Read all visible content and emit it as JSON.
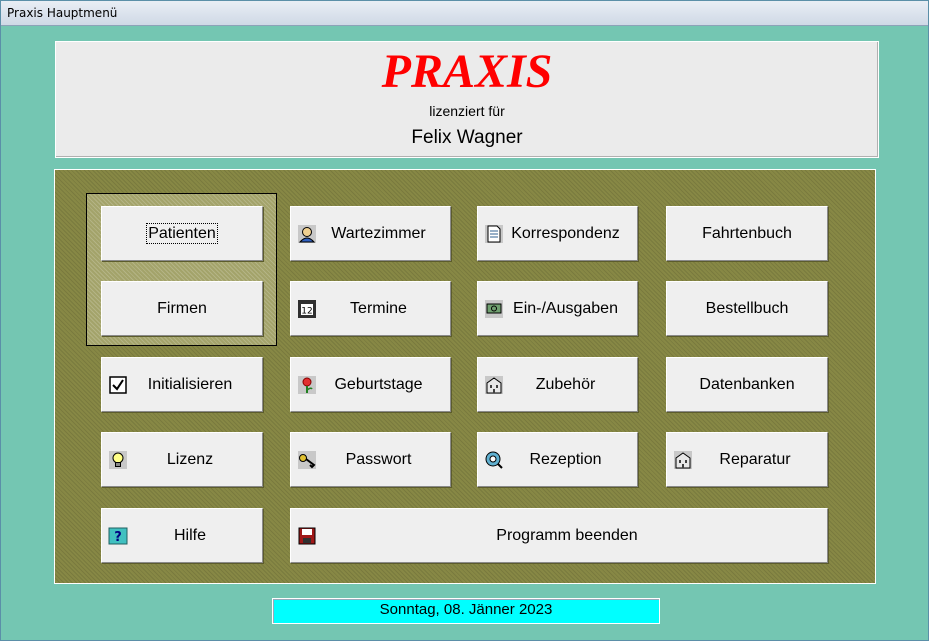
{
  "window": {
    "title": "Praxis Hauptmenü"
  },
  "header": {
    "app_name": "PRAXIS",
    "licensed_for": "lizenziert für",
    "licensee": "Felix Wagner"
  },
  "buttons": {
    "patienten": "Patienten",
    "firmen": "Firmen",
    "initialisieren": "Initialisieren",
    "lizenz": "Lizenz",
    "hilfe": "Hilfe",
    "wartezimmer": "Wartezimmer",
    "termine": "Termine",
    "geburtstage": "Geburtstage",
    "passwort": "Passwort",
    "programm_beenden": "Programm beenden",
    "korrespondenz": "Korrespondenz",
    "ein_ausgaben": "Ein-/Ausgaben",
    "zubehoer": "Zubehör",
    "rezeption": "Rezeption",
    "fahrtenbuch": "Fahrtenbuch",
    "bestellbuch": "Bestellbuch",
    "datenbanken": "Datenbanken",
    "reparatur": "Reparatur"
  },
  "icons": {
    "initialisieren": "checkbox-icon",
    "lizenz": "lightbulb-icon",
    "hilfe": "question-icon",
    "wartezimmer": "person-icon",
    "termine": "calendar-icon",
    "geburtstage": "flower-icon",
    "passwort": "key-icon",
    "programm_beenden": "exit-disk-icon",
    "korrespondenz": "document-icon",
    "ein_ausgaben": "money-icon",
    "zubehoer": "building-icon",
    "rezeption": "reception-icon",
    "reparatur": "building-icon"
  },
  "colors": {
    "title_red": "#ff0000",
    "status_cyan": "#00ffff",
    "panel_olive": "#878845",
    "background_teal": "#74c6b2"
  },
  "status": {
    "date": "Sonntag, 08. Jänner 2023"
  }
}
